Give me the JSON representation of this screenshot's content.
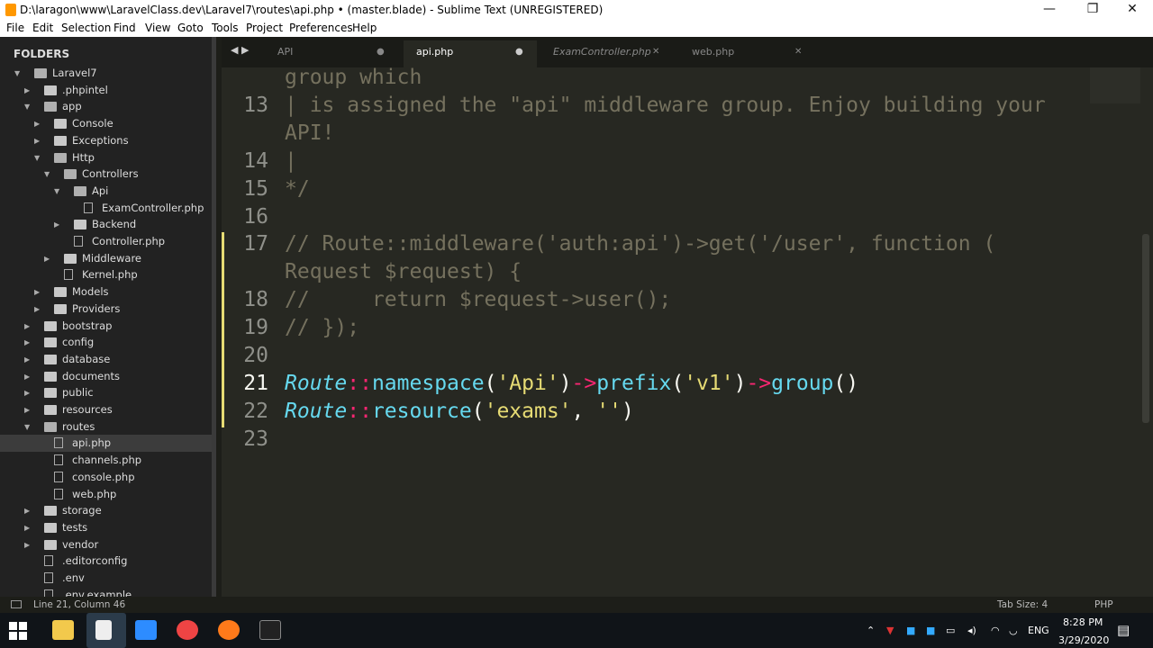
{
  "window": {
    "title": "D:\\laragon\\www\\LaravelClass.dev\\Laravel7\\routes\\api.php • (master.blade) - Sublime Text (UNREGISTERED)",
    "minimize": "—",
    "maximize": "❐",
    "close": "✕"
  },
  "menu": [
    "File",
    "Edit",
    "Selection",
    "Find",
    "View",
    "Goto",
    "Tools",
    "Project",
    "Preferences",
    "Help"
  ],
  "sidebar": {
    "header": "FOLDERS",
    "items": [
      {
        "label": "Laravel7",
        "depth": 0,
        "type": "folder",
        "open": true
      },
      {
        "label": ".phpintel",
        "depth": 1,
        "type": "folder",
        "open": false
      },
      {
        "label": "app",
        "depth": 1,
        "type": "folder",
        "open": true
      },
      {
        "label": "Console",
        "depth": 2,
        "type": "folder",
        "open": false
      },
      {
        "label": "Exceptions",
        "depth": 2,
        "type": "folder",
        "open": false
      },
      {
        "label": "Http",
        "depth": 2,
        "type": "folder",
        "open": true
      },
      {
        "label": "Controllers",
        "depth": 3,
        "type": "folder",
        "open": true
      },
      {
        "label": "Api",
        "depth": 4,
        "type": "folder",
        "open": true
      },
      {
        "label": "ExamController.php",
        "depth": 5,
        "type": "file"
      },
      {
        "label": "Backend",
        "depth": 4,
        "type": "folder",
        "open": false
      },
      {
        "label": "Controller.php",
        "depth": 4,
        "type": "file"
      },
      {
        "label": "Middleware",
        "depth": 3,
        "type": "folder",
        "open": false
      },
      {
        "label": "Kernel.php",
        "depth": 3,
        "type": "file"
      },
      {
        "label": "Models",
        "depth": 2,
        "type": "folder",
        "open": false
      },
      {
        "label": "Providers",
        "depth": 2,
        "type": "folder",
        "open": false
      },
      {
        "label": "bootstrap",
        "depth": 1,
        "type": "folder",
        "open": false
      },
      {
        "label": "config",
        "depth": 1,
        "type": "folder",
        "open": false
      },
      {
        "label": "database",
        "depth": 1,
        "type": "folder",
        "open": false
      },
      {
        "label": "documents",
        "depth": 1,
        "type": "folder",
        "open": false
      },
      {
        "label": "public",
        "depth": 1,
        "type": "folder",
        "open": false
      },
      {
        "label": "resources",
        "depth": 1,
        "type": "folder",
        "open": false
      },
      {
        "label": "routes",
        "depth": 1,
        "type": "folder",
        "open": true
      },
      {
        "label": "api.php",
        "depth": 2,
        "type": "file",
        "selected": true
      },
      {
        "label": "channels.php",
        "depth": 2,
        "type": "file"
      },
      {
        "label": "console.php",
        "depth": 2,
        "type": "file"
      },
      {
        "label": "web.php",
        "depth": 2,
        "type": "file"
      },
      {
        "label": "storage",
        "depth": 1,
        "type": "folder",
        "open": false
      },
      {
        "label": "tests",
        "depth": 1,
        "type": "folder",
        "open": false
      },
      {
        "label": "vendor",
        "depth": 1,
        "type": "folder",
        "open": false
      },
      {
        "label": ".editorconfig",
        "depth": 1,
        "type": "file"
      },
      {
        "label": ".env",
        "depth": 1,
        "type": "file"
      },
      {
        "label": ".env.example",
        "depth": 1,
        "type": "file"
      }
    ]
  },
  "tabs": [
    {
      "label": "API",
      "mark": "●",
      "active": false,
      "italic": false
    },
    {
      "label": "api.php",
      "mark": "●",
      "active": true,
      "italic": false
    },
    {
      "label": "ExamController.php",
      "mark": "✕",
      "active": false,
      "italic": true
    },
    {
      "label": "web.php",
      "mark": "✕",
      "active": false,
      "italic": false
    }
  ],
  "tab_nav": "◀ ▶",
  "editor": {
    "lines": [
      {
        "num": "",
        "html": "<span class='cm'>group which</span>"
      },
      {
        "num": "13",
        "html": "<span class='cm'>| is assigned the \"api\" middleware group. Enjoy building your</span>"
      },
      {
        "num": "",
        "html": "<span class='cm'>API!</span>"
      },
      {
        "num": "14",
        "html": "<span class='cm'>|</span>"
      },
      {
        "num": "15",
        "html": "<span class='cm'>*/</span>"
      },
      {
        "num": "16",
        "html": ""
      },
      {
        "num": "17",
        "html": "<span class='cm'>// Route::middleware('auth:api')-&gt;get('/user', function (</span>",
        "mod": true
      },
      {
        "num": "",
        "html": "<span class='cm'>Request $request) {</span>",
        "mod": true
      },
      {
        "num": "18",
        "html": "<span class='cm'>//     return $request-&gt;user();</span>",
        "mod": true
      },
      {
        "num": "19",
        "html": "<span class='cm'>// });</span>",
        "mod": true
      },
      {
        "num": "20",
        "html": "",
        "mod": true
      },
      {
        "num": "21",
        "html": "<span class='cls'>Route</span><span class='op'>::</span><span class='fn'>namespace</span><span class='pn'>(</span><span class='str'>'Api'</span><span class='pn'>)</span><span class='op'>-&gt;</span><span class='fn'>prefix</span><span class='pn'>(</span><span class='str'>'v1'</span><span class='pn'>)</span><span class='op'>-&gt;</span><span class='fn'>group</span><span class='pn'>()</span>",
        "mod": true,
        "current": true
      },
      {
        "num": "22",
        "html": "<span class='cls'>Route</span><span class='op'>::</span><span class='fn'>resource</span><span class='pn'>(</span><span class='str'>'exams'</span><span class='pn'>, </span><span class='str'>''</span><span class='pn'>)</span>",
        "mod": true
      },
      {
        "num": "23",
        "html": ""
      }
    ]
  },
  "status": {
    "position": "Line 21, Column 46",
    "tab_size": "Tab Size: 4",
    "syntax": "PHP"
  },
  "taskbar": {
    "time": "8:28 PM",
    "date": "3/29/2020",
    "lang": "ENG"
  },
  "colors": {
    "accent": "#e6db74",
    "editor_bg": "#272822",
    "sidebar_bg": "#222222"
  }
}
